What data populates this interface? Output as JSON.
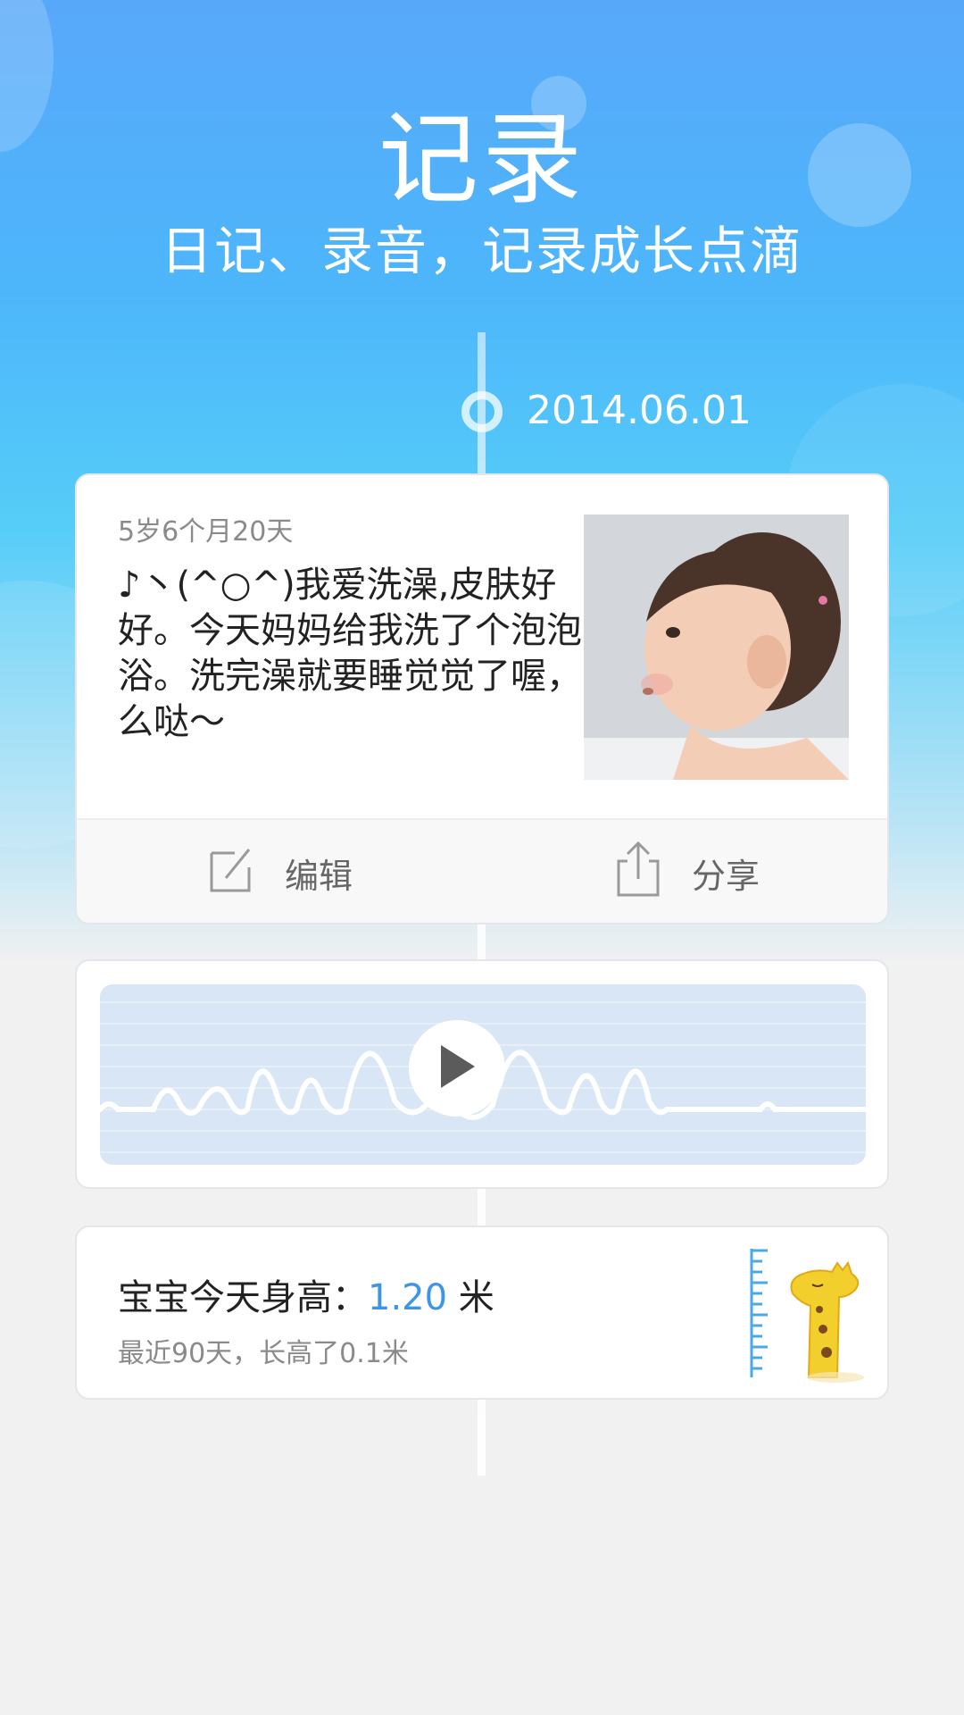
{
  "header": {
    "title": "记录",
    "subtitle": "日记、录音，记录成长点滴"
  },
  "timeline": {
    "date": "2014.06.01"
  },
  "diary": {
    "age": "5岁6个月20天",
    "text": "♪丶(^○^)我爱洗澡,皮肤好好。今天妈妈给我洗了个泡泡浴。洗完澡就要睡觉觉了喔，么么哒～",
    "photo_icon": "baby-photo",
    "actions": {
      "edit_label": "编辑",
      "edit_icon": "edit-icon",
      "share_label": "分享",
      "share_icon": "share-icon"
    }
  },
  "audio": {
    "play_icon": "play-icon",
    "panel_color": "#d9e6f5"
  },
  "growth": {
    "label": "宝宝今天身高：",
    "value": "1.20",
    "unit": " 米",
    "sub": "最近90天，长高了0.1米",
    "value_color": "#3d95e8",
    "illustration_icon": "giraffe-ruler-icon"
  }
}
